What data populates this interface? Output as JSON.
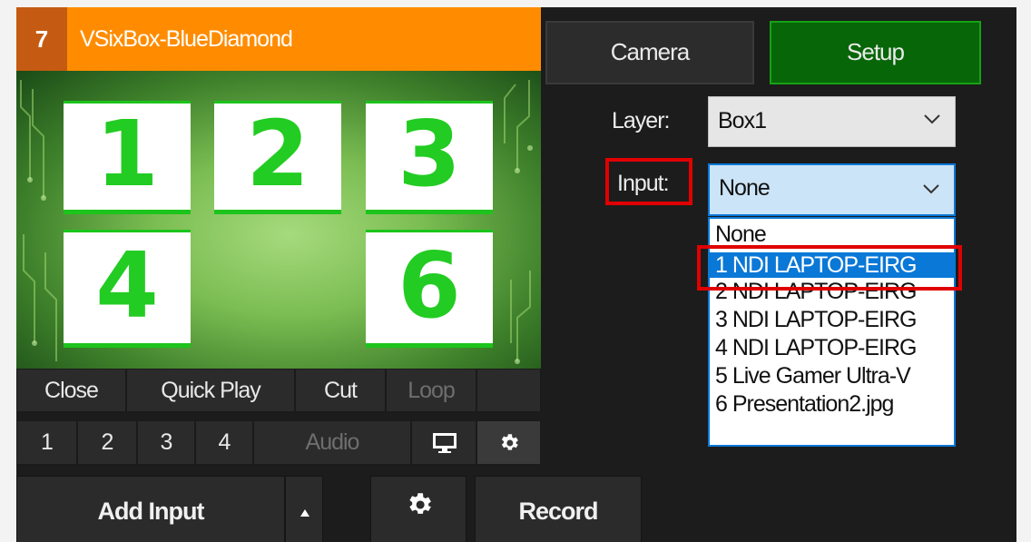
{
  "input": {
    "number": "7",
    "title": "VSixBox-BlueDiamond",
    "tiles": [
      "1",
      "2",
      "3",
      "4",
      "6"
    ]
  },
  "controls": {
    "close": "Close",
    "quick_play": "Quick Play",
    "cut": "Cut",
    "loop": "Loop",
    "overlays": [
      "1",
      "2",
      "3",
      "4"
    ],
    "audio": "Audio"
  },
  "panel": {
    "camera_tab": "Camera",
    "setup_tab": "Setup",
    "layer_label": "Layer:",
    "layer_value": "Box1",
    "input_label": "Input:",
    "input_value": "None",
    "input_options": [
      "None",
      "1 NDI LAPTOP-EIRG",
      "2 NDI LAPTOP-EIRG",
      "3 NDI LAPTOP-EIRG",
      "4 NDI LAPTOP-EIRG",
      "5 Live Gamer Ultra-V",
      "6 Presentation2.jpg"
    ],
    "highlighted_option": 1
  },
  "bottom": {
    "add_input": "Add Input",
    "record": "Record"
  },
  "colors": {
    "header": "#ff8c00",
    "header_number_bg": "#c55b12",
    "setup_active": "#076607",
    "dropdown_selected": "#0a78d7",
    "annotation": "#e00000"
  },
  "icons": {
    "monitor": "monitor-icon",
    "settings": "gear-icon",
    "expand": "triangle-up-icon",
    "dropdown": "chevron-down-icon"
  }
}
